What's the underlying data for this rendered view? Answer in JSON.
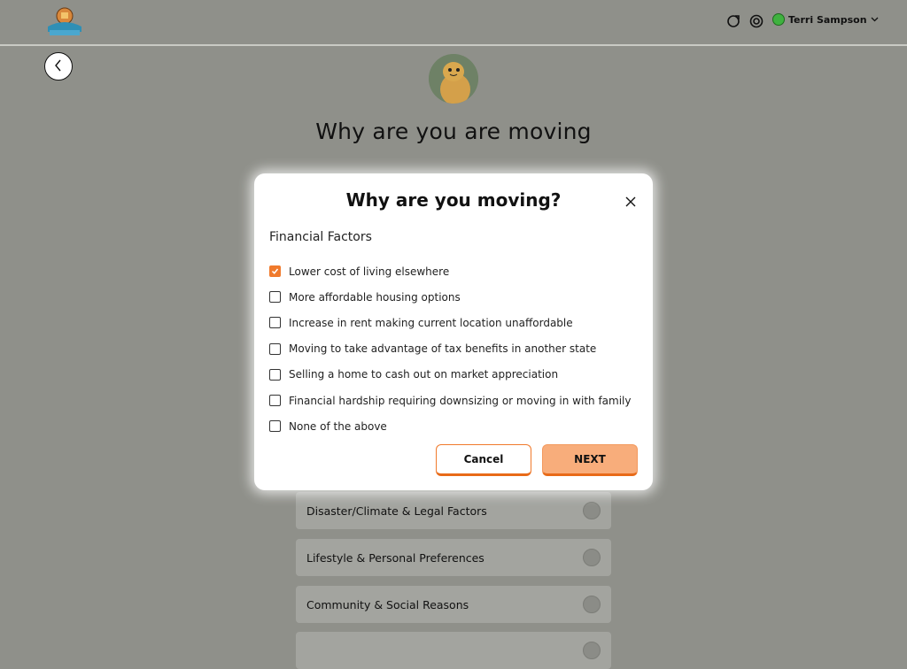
{
  "header": {
    "user_name": "Terri Sampson"
  },
  "page": {
    "title": "Why are you are moving",
    "categories": [
      "Disaster/Climate & Legal Factors",
      "Lifestyle & Personal Preferences",
      "Community & Social Reasons"
    ]
  },
  "modal": {
    "title": "Why are you moving?",
    "section": "Financial Factors",
    "options": [
      {
        "label": "Lower cost of living elsewhere",
        "checked": true
      },
      {
        "label": "More affordable housing options",
        "checked": false
      },
      {
        "label": "Increase in rent making current location unaffordable",
        "checked": false
      },
      {
        "label": "Moving to take advantage of tax benefits in another state",
        "checked": false
      },
      {
        "label": "Selling a home to cash out on market appreciation",
        "checked": false
      },
      {
        "label": "Financial hardship requiring downsizing or moving in with family",
        "checked": false
      },
      {
        "label": "None of the above",
        "checked": false
      }
    ],
    "cancel_label": "Cancel",
    "next_label": "NEXT"
  },
  "colors": {
    "accent": "#f07a2c",
    "overlay": "#8f908a"
  }
}
